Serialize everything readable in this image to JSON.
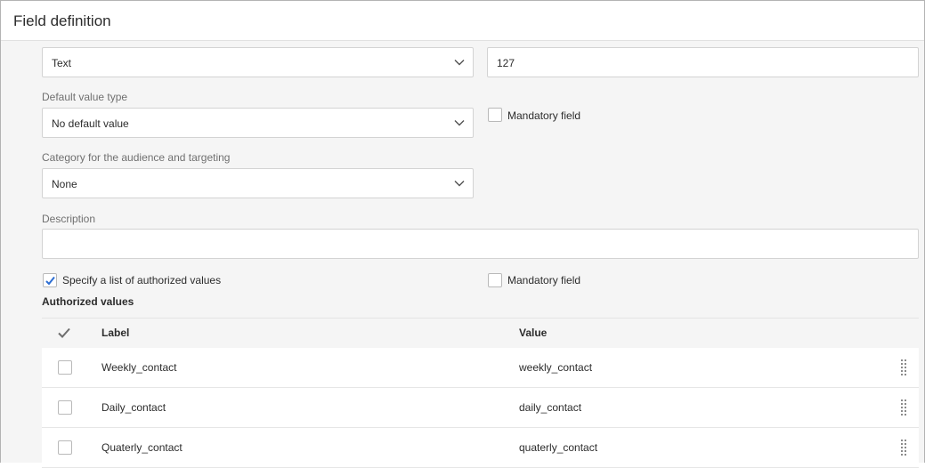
{
  "dialog": {
    "title": "Field definition"
  },
  "form": {
    "type_select": {
      "value": "Text",
      "icon": "chevron-down-icon"
    },
    "length_input": {
      "value": "127"
    },
    "default_value_type": {
      "label": "Default value type",
      "value": "No default value",
      "icon": "chevron-down-icon"
    },
    "mandatory_field_1": {
      "label": "Mandatory field",
      "checked": false
    },
    "category": {
      "label": "Category for the audience and targeting",
      "value": "None",
      "icon": "chevron-down-icon"
    },
    "description": {
      "label": "Description",
      "value": ""
    },
    "authorized_values_checkbox": {
      "label": "Specify a list of authorized values",
      "checked": true
    },
    "mandatory_field_2": {
      "label": "Mandatory field",
      "checked": false
    }
  },
  "authorized_values": {
    "title": "Authorized values",
    "columns": {
      "select_all_icon": "checkmark-icon",
      "label": "Label",
      "value": "Value"
    },
    "rows": [
      {
        "label": "Weekly_contact",
        "value": "weekly_contact"
      },
      {
        "label": "Daily_contact",
        "value": "daily_contact"
      },
      {
        "label": "Quaterly_contact",
        "value": "quaterly_contact"
      }
    ],
    "row_icon": "drag-handle-icon"
  },
  "colors": {
    "accent": "#2d6ed2",
    "border": "#d3d3d3",
    "background": "#f5f5f5"
  }
}
